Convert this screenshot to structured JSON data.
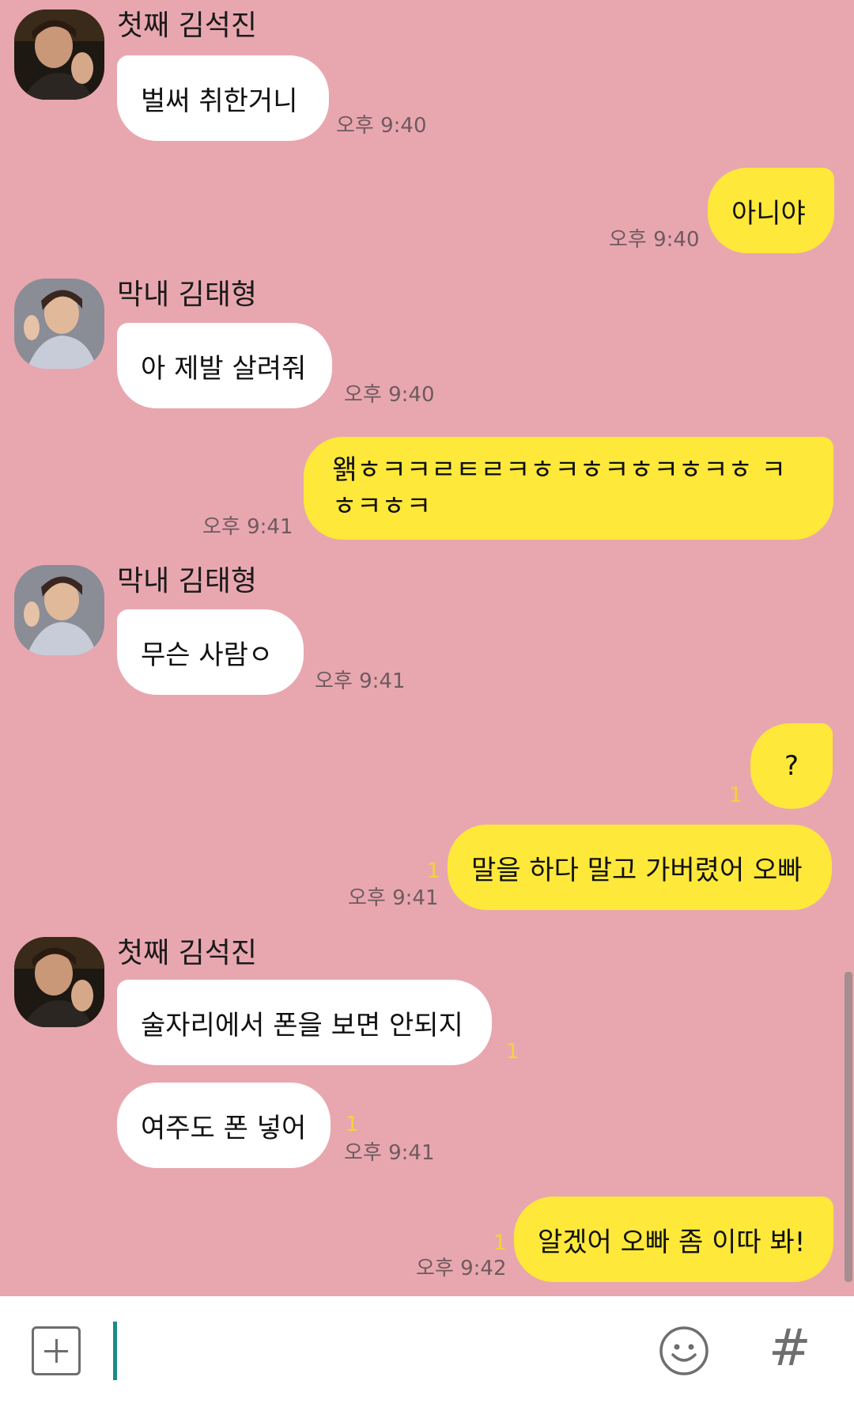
{
  "messages": [
    {
      "sender": "첫째 김석진",
      "text": "벌써 취한거니",
      "time": "오후 9:40"
    },
    {
      "sender": "me",
      "text": "아니야",
      "time": "오후 9:40"
    },
    {
      "sender": "막내 김태형",
      "text": "아 제발 살려줘",
      "time": "오후 9:40"
    },
    {
      "sender": "me",
      "text": "왥ㅎㅋㅋㄹㅌㄹㅋㅎㅋㅎㅋㅎㅋㅎㅋㅎ ㅋㅎㅋㅎㅋ",
      "time": "오후 9:41"
    },
    {
      "sender": "막내 김태형",
      "text": "무슨 사람ㅇ",
      "time": "오후 9:41"
    },
    {
      "sender": "me",
      "text": "?",
      "unread": "1"
    },
    {
      "sender": "me",
      "text": "말을 하다 말고 가버렸어 오빠",
      "time": "오후 9:41",
      "unread": "1"
    },
    {
      "sender": "첫째 김석진",
      "text": "술자리에서 폰을 보면 안되지",
      "unread": "1"
    },
    {
      "sender": "첫째 김석진",
      "text": "여주도 폰 넣어",
      "time": "오후 9:41",
      "unread": "1"
    },
    {
      "sender": "me",
      "text": "알겠어 오빠 좀 이따 봐!",
      "time": "오후 9:42",
      "unread": "1"
    }
  ],
  "input": {
    "value": ""
  },
  "icons": {
    "attach": "plus-icon",
    "emoji": "emoji-icon",
    "hashtag": "hash-icon",
    "hash_glyph": "#"
  },
  "colors": {
    "background": "#e8a7af",
    "my_bubble": "#fee83a",
    "their_bubble": "#ffffff",
    "unread": "#f2d33a"
  }
}
